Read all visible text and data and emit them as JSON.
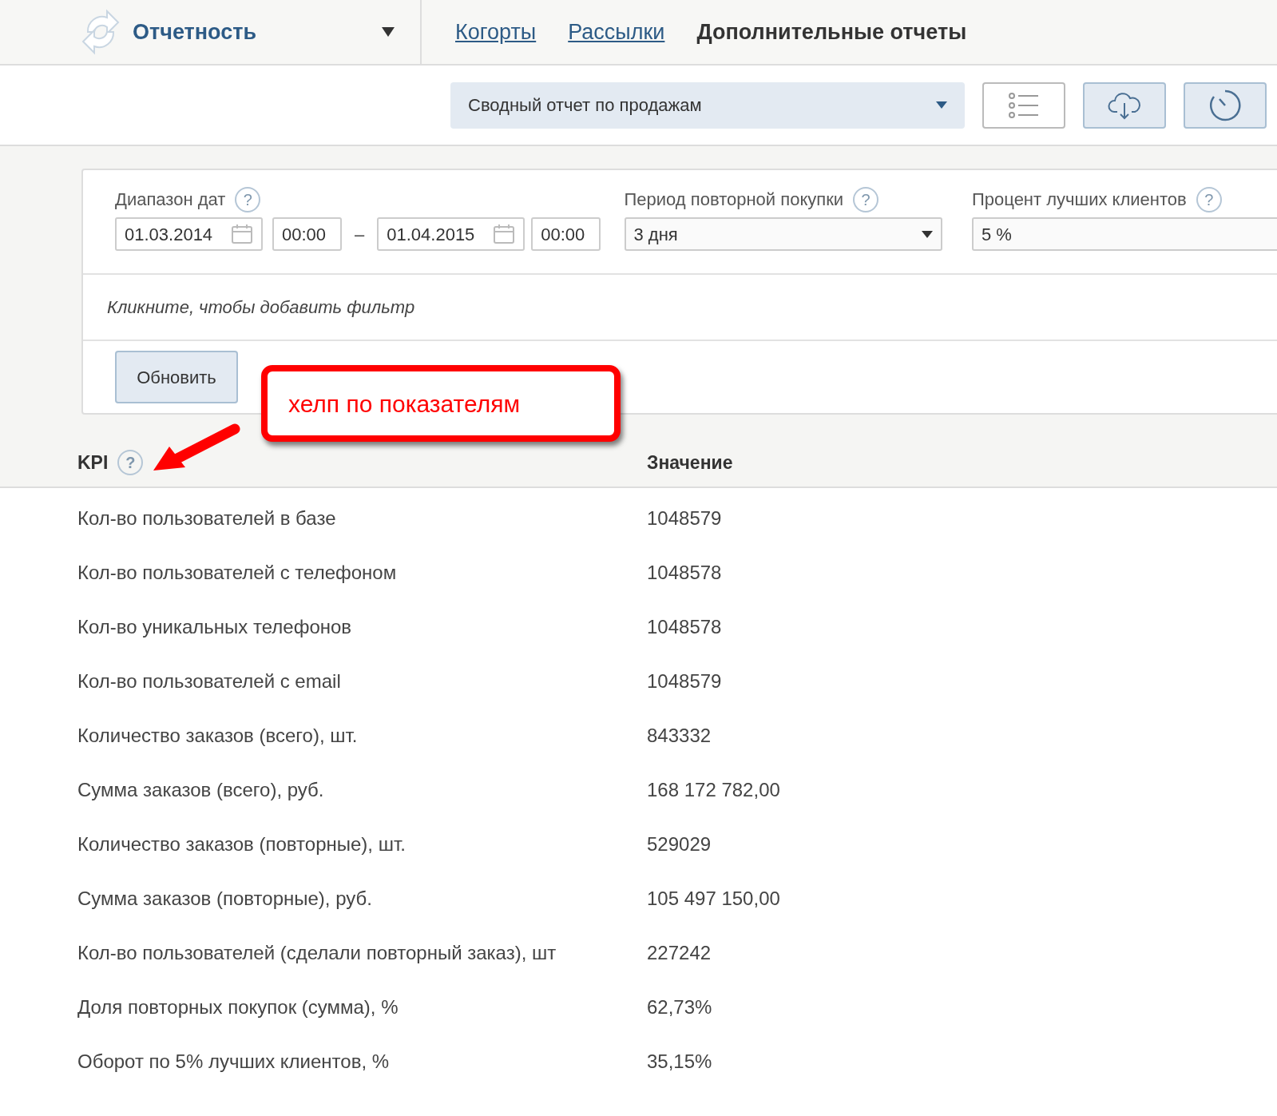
{
  "header": {
    "section": "Отчетность",
    "nav": [
      {
        "label": "Когорты",
        "selected": false
      },
      {
        "label": "Рассылки",
        "selected": false
      },
      {
        "label": "Дополнительные отчеты",
        "selected": true
      }
    ]
  },
  "toolbar": {
    "report": "Сводный отчет по продажам"
  },
  "filters": {
    "date_range": {
      "label": "Диапазон дат",
      "help": "?",
      "from_date": "01.03.2014",
      "from_time": "00:00",
      "separator": "–",
      "to_date": "01.04.2015",
      "to_time": "00:00"
    },
    "repeat_period": {
      "label": "Период повторной покупки",
      "help": "?",
      "value": "3 дня"
    },
    "top_clients": {
      "label": "Процент лучших клиентов",
      "help": "?",
      "value": "5 %"
    },
    "add_filter_hint": "Кликните, чтобы добавить фильтр",
    "refresh_button": "Обновить"
  },
  "annotation": {
    "text": "хелп по показателям"
  },
  "table": {
    "columns": [
      {
        "label": "KPI",
        "help": "?"
      },
      {
        "label": "Значение"
      }
    ],
    "rows": [
      [
        "Кол-во пользователей в базе",
        "1048579"
      ],
      [
        "Кол-во пользователей с телефоном",
        "1048578"
      ],
      [
        "Кол-во уникальных телефонов",
        "1048578"
      ],
      [
        "Кол-во пользователей с email",
        "1048579"
      ],
      [
        "Количество заказов (всего), шт.",
        "843332"
      ],
      [
        "Сумма заказов (всего), руб.",
        "168 172 782,00"
      ],
      [
        "Количество заказов (повторные), шт.",
        "529029"
      ],
      [
        "Сумма заказов (повторные), руб.",
        "105 497 150,00"
      ],
      [
        "Кол-во пользователей (сделали повторный заказ), шт",
        "227242"
      ],
      [
        "Доля повторных покупок (сумма), %",
        "62,73%"
      ],
      [
        "Оборот по 5% лучших клиентов, %",
        "35,15%"
      ]
    ]
  }
}
